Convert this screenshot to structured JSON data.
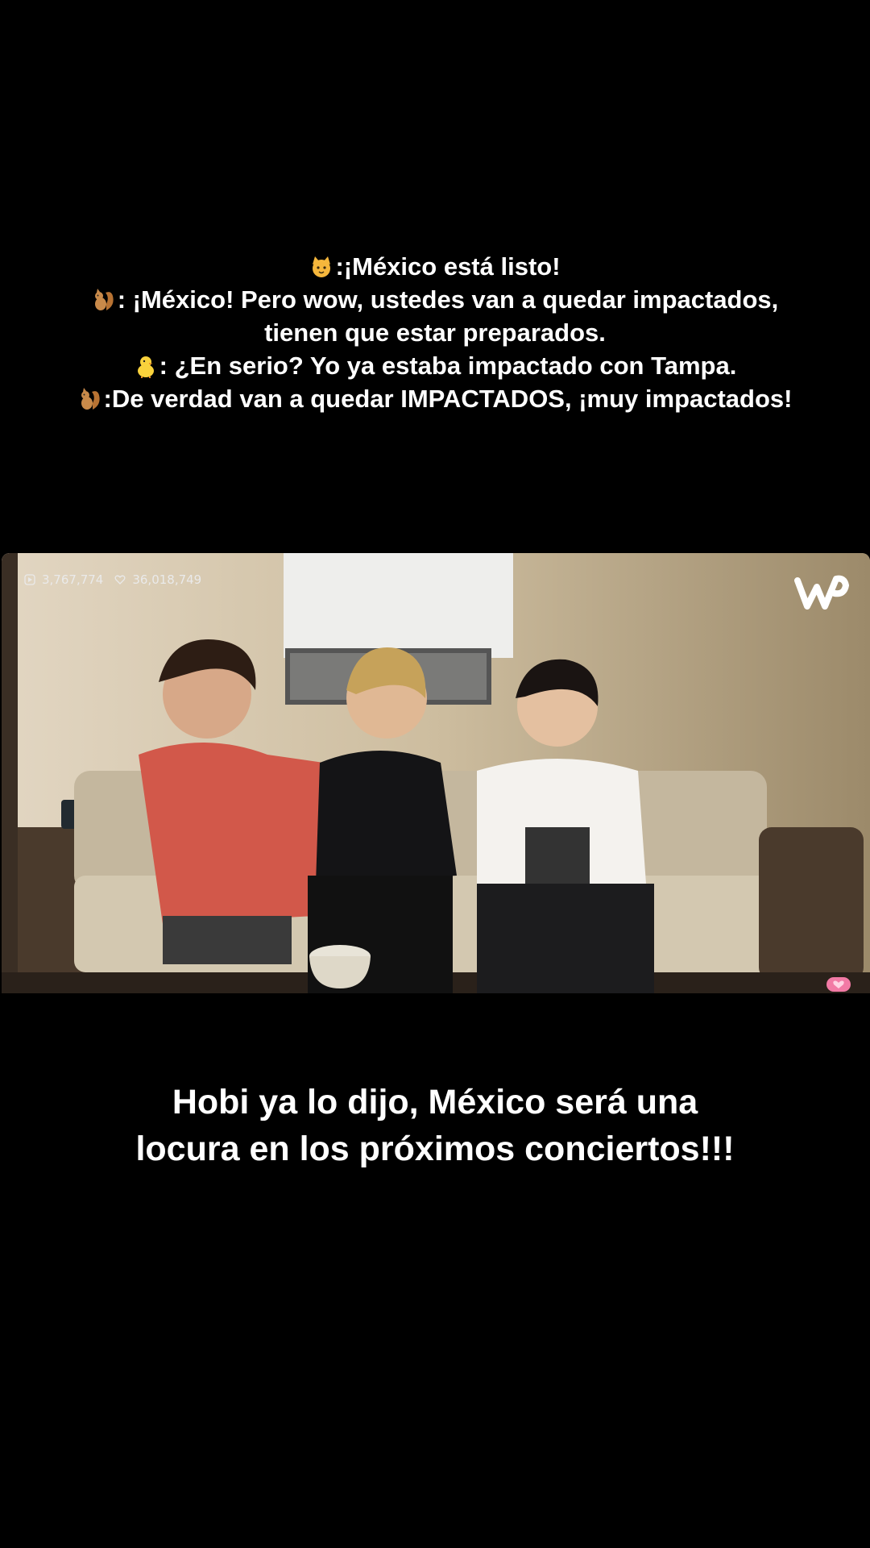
{
  "caption": {
    "lines": [
      {
        "icon": "cat-face-icon",
        "text": ":¡México está listo!"
      },
      {
        "icon": "squirrel-icon",
        "text": ": ¡México! Pero wow, ustedes van a quedar impactados,"
      },
      {
        "icon": "",
        "text": "tienen que estar preparados."
      },
      {
        "icon": "baby-chick-icon",
        "text": ": ¿En serio? Yo ya estaba impactado con Tampa."
      },
      {
        "icon": "squirrel-icon",
        "text": ":De verdad van a quedar IMPACTADOS, ¡muy impactados!"
      }
    ]
  },
  "video": {
    "views": "3,767,774",
    "likes": "36,018,749",
    "logo": "weverse-logo-icon"
  },
  "bottom_caption": {
    "line1": "Hobi ya lo dijo, México será una",
    "line2": "locura en los próximos conciertos!!!"
  },
  "colors": {
    "background": "#000000",
    "text": "#ffffff",
    "wall": "#c8b89b",
    "shirt_red": "#d2584a",
    "badge_pink": "#f27aa5"
  }
}
